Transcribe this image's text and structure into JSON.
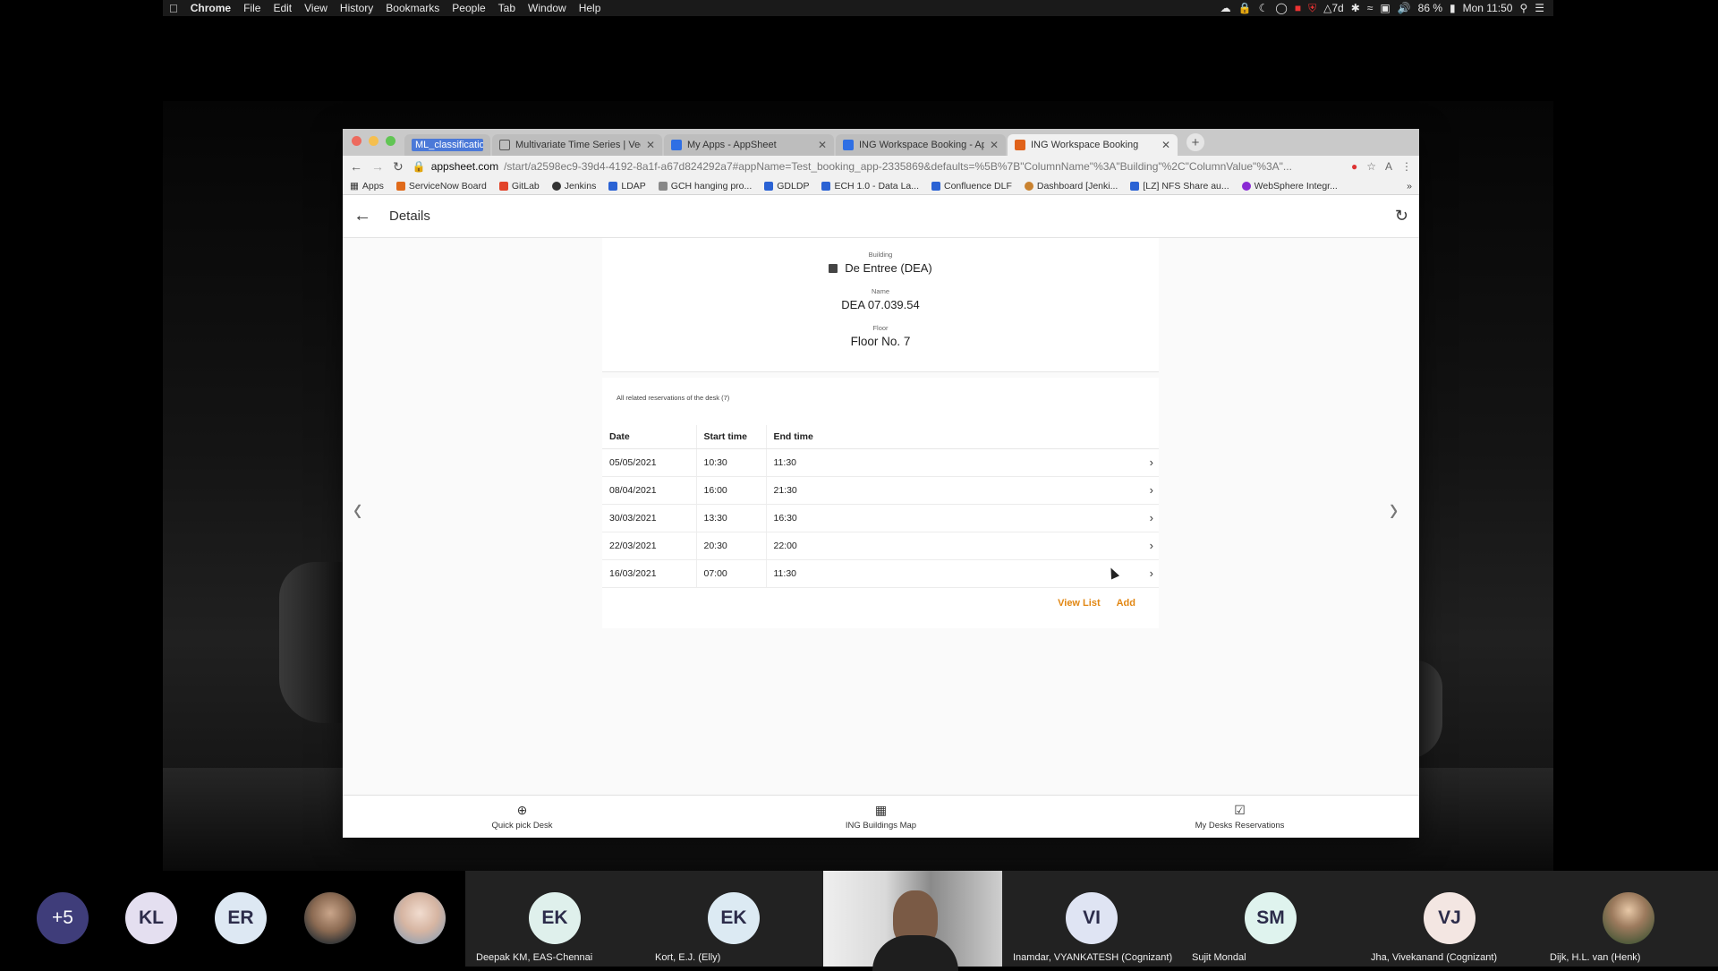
{
  "menubar": {
    "apple": "",
    "app": "Chrome",
    "menus": [
      "File",
      "Edit",
      "View",
      "History",
      "Bookmarks",
      "People",
      "Tab",
      "Window",
      "Help"
    ],
    "status": {
      "time_label": "Mon 11:50",
      "battery": "86 %",
      "notif_badge": "7d"
    }
  },
  "browser": {
    "tabs": [
      {
        "label": "ML_classification",
        "highlight": true,
        "color": "#3a6fd8"
      },
      {
        "label": "Multivariate Time Series | Vect",
        "color": "#555555"
      },
      {
        "label": "My Apps - AppSheet",
        "color": "#2f6fe4"
      },
      {
        "label": "ING Workspace Booking - App",
        "color": "#2f6fe4"
      },
      {
        "label": "ING Workspace Booking",
        "active": true,
        "color": "#e0621a"
      }
    ],
    "url_domain": "appsheet.com",
    "url_path": "/start/a2598ec9-39d4-4192-8a1f-a67d824292a7#appName=Test_booking_app-2335869&defaults=%5B%7B\"ColumnName\"%3A\"Building\"%2C\"ColumnValue\"%3A\"...",
    "bookmarks": [
      {
        "label": "Apps",
        "color": "#777777"
      },
      {
        "label": "ServiceNow Board",
        "color": "#e06a1a"
      },
      {
        "label": "GitLab",
        "color": "#e24329"
      },
      {
        "label": "Jenkins",
        "color": "#333333"
      },
      {
        "label": "LDAP",
        "color": "#2a62d4"
      },
      {
        "label": "GCH hanging pro...",
        "color": "#888888"
      },
      {
        "label": "GDLDP",
        "color": "#2a62d4"
      },
      {
        "label": "ECH 1.0 - Data La...",
        "color": "#2a62d4"
      },
      {
        "label": "Confluence DLF",
        "color": "#2a62d4"
      },
      {
        "label": "Dashboard [Jenki...",
        "color": "#c9822f"
      },
      {
        "label": "[LZ] NFS Share au...",
        "color": "#2a62d4"
      },
      {
        "label": "WebSphere Integr...",
        "color": "#8a2ad4"
      }
    ]
  },
  "app": {
    "header_title": "Details",
    "building_label": "Building",
    "building_value": "De Entree (DEA)",
    "name_label": "Name",
    "name_value": "DEA 07.039.54",
    "floor_label": "Floor",
    "floor_value": "Floor No. 7",
    "related_caption": "All related reservations of the desk (7)",
    "table": {
      "columns": [
        "Date",
        "Start time",
        "End time"
      ],
      "rows": [
        [
          "05/05/2021",
          "10:30",
          "11:30"
        ],
        [
          "08/04/2021",
          "16:00",
          "21:30"
        ],
        [
          "30/03/2021",
          "13:30",
          "16:30"
        ],
        [
          "22/03/2021",
          "20:30",
          "22:00"
        ],
        [
          "16/03/2021",
          "07:00",
          "11:30"
        ]
      ]
    },
    "view_list_label": "View List",
    "add_label": "Add",
    "accent_color": "#e28713",
    "bottom_nav": [
      {
        "label": "Quick pick Desk",
        "icon": "crosshair-icon"
      },
      {
        "label": "ING Buildings Map",
        "icon": "building-icon"
      },
      {
        "label": "My Desks Reservations",
        "icon": "calendar-check-icon"
      }
    ]
  },
  "participants": [
    {
      "initials": "+5",
      "color": "#3f3d7a",
      "text_color": "#ffffff"
    },
    {
      "initials": "KL",
      "color": "#e4dff0"
    },
    {
      "initials": "ER",
      "color": "#dde8f3"
    },
    {
      "initials": "",
      "photo": "photo"
    },
    {
      "initials": "",
      "photo": "photo2"
    },
    {
      "initials": "EK",
      "name": "Deepak KM, EAS-Chennai",
      "color": "#dff0ec"
    },
    {
      "initials": "EK",
      "name": "Kort, E.J. (Elly)",
      "color": "#dceaf3"
    },
    {
      "initials": "",
      "name": "",
      "video": true
    },
    {
      "initials": "VI",
      "name": "Inamdar, VYANKATESH (Cognizant)",
      "color": "#dfe4f3"
    },
    {
      "initials": "SM",
      "name": "Sujit Mondal",
      "color": "#dff3ee"
    },
    {
      "initials": "VJ",
      "name": "Jha, Vivekanand (Cognizant)",
      "color": "#f3e6e2"
    },
    {
      "initials": "",
      "name": "Dijk, H.L. van (Henk)",
      "photo": "photo3"
    }
  ]
}
